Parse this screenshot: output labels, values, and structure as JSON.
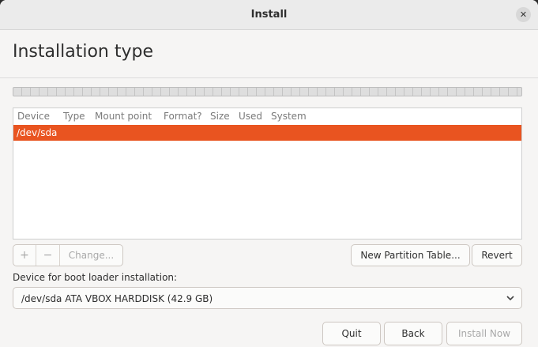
{
  "window": {
    "title": "Install",
    "close_glyph": "✕"
  },
  "page": {
    "title": "Installation type"
  },
  "table": {
    "columns": [
      "Device",
      "Type",
      "Mount point",
      "Format?",
      "Size",
      "Used",
      "System"
    ],
    "rows": [
      {
        "device": "/dev/sda",
        "selected": true
      }
    ],
    "selection_color": "#e95420"
  },
  "toolbar": {
    "add_glyph": "+",
    "remove_glyph": "−",
    "change_label": "Change...",
    "new_partition_table_label": "New Partition Table...",
    "revert_label": "Revert"
  },
  "boot_loader": {
    "label": "Device for boot loader installation:",
    "selected": "/dev/sda ATA VBOX HARDDISK (42.9 GB)",
    "chevron_icon": "chevron-down-icon"
  },
  "footer": {
    "quit_label": "Quit",
    "back_label": "Back",
    "install_now_label": "Install Now"
  }
}
